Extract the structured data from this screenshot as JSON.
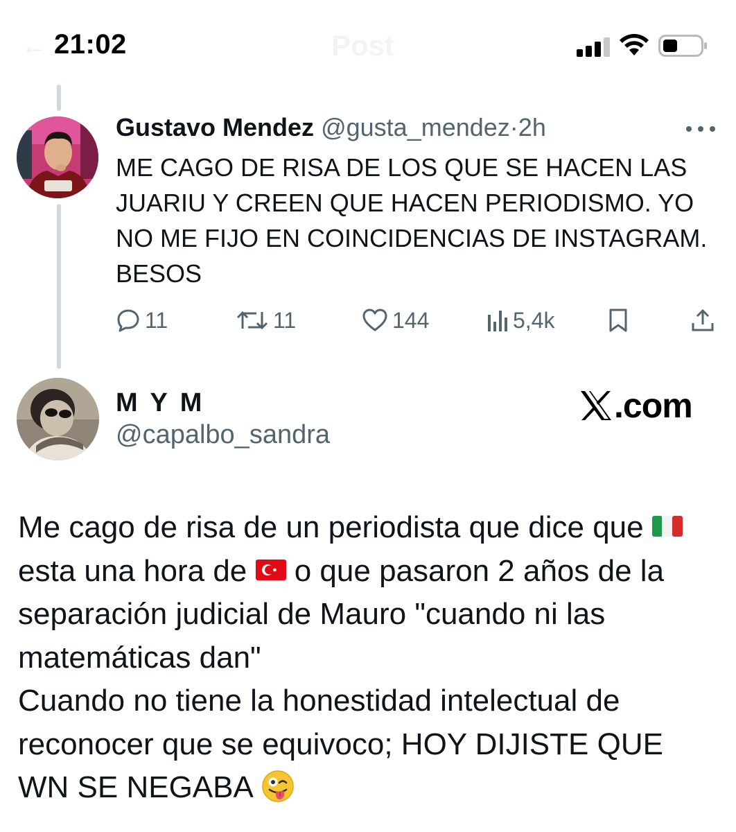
{
  "status_bar": {
    "time": "21:02",
    "ghost_title": "Post",
    "ghost_back": "←",
    "signal_icon": "cellular-signal-icon",
    "wifi_icon": "wifi-icon",
    "battery_icon": "battery-low-icon"
  },
  "tweet_1": {
    "author_name": "Gustavo Mendez",
    "handle": "@gusta_mendez",
    "separator": "·",
    "time": "2h",
    "more_icon": "more-horizontal-icon",
    "text": "ME CAGO DE RISA DE LOS QUE SE HACEN LAS JUARIU Y CREEN QUE HACEN PERIODISMO. YO NO ME FIJO EN COINCIDENCIAS DE INSTAGRAM. BESOS",
    "actions": {
      "replies": "11",
      "reposts": "11",
      "likes": "144",
      "views": "5,4k"
    }
  },
  "tweet_2": {
    "author_name": "M Y M",
    "handle": "@capalbo_sandra",
    "watermark": ".com",
    "lines": [
      "Me cago de risa de un periodista que dice que",
      "esta una hora de",
      "o que pasaron 2 años de la",
      "separación judicial de Mauro \"cuando ni las",
      "matemáticas dan\"",
      "Cuando no tiene la honestidad intelectual de",
      "reconocer que se equivoco; HOY DIJISTE QUE",
      "WN SE NEGABA"
    ],
    "flag_1": "italy-flag-emoji",
    "flag_2": "turkey-flag-emoji",
    "emoji_end": "winking-face-with-tongue-emoji"
  },
  "colors": {
    "text_primary": "#0f1419",
    "text_secondary": "#536471",
    "thread_line": "#cfd9de"
  }
}
